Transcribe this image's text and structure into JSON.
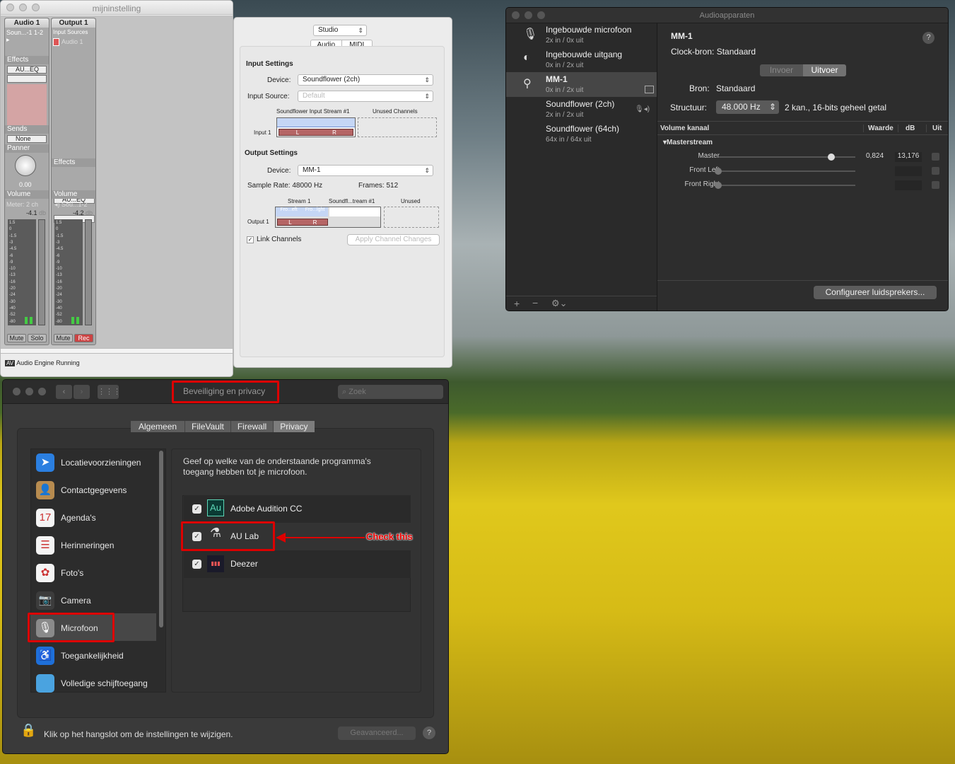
{
  "aulab": {
    "window_title": "mijninstelling",
    "strip1": {
      "title": "Audio 1",
      "source": "Soun...-1 1-2",
      "effects": "Effects",
      "effect1": "AU...EQ",
      "sends": "Sends",
      "send1": "None",
      "panner": "Panner",
      "pan_value": "0.00",
      "volume": "Volume",
      "meter": "Meter: 2 ch",
      "db": "-4.1",
      "db_unit": "db",
      "mute": "Mute",
      "solo": "Solo"
    },
    "strip2": {
      "title": "Output 1",
      "input_sources": "Input Sources",
      "input1": "Audio 1",
      "effects": "Effects",
      "effect1": "AU...EQ",
      "volume": "Volume",
      "output": "Sou...1-2",
      "db": "-4.2",
      "db_unit": "db",
      "mute": "Mute",
      "rec": "Rec"
    },
    "scale": [
      "1.5",
      "0",
      "-1.5",
      "-3",
      "-4.5",
      "-6",
      "-9",
      "-10",
      "-13",
      "-16",
      "-20",
      "-24",
      "-30",
      "-40",
      "-52",
      "-80"
    ],
    "status": "Audio Engine Running"
  },
  "midi": {
    "config": "Studio",
    "tab_audio": "Audio",
    "tab_midi": "MIDI",
    "input_settings": "Input Settings",
    "device_label": "Device:",
    "input_device": "Soundflower (2ch)",
    "input_source_label": "Input Source:",
    "input_source": "Default",
    "in_stream": "Soundflower Input Stream #1",
    "unused_channels": "Unused Channels",
    "input1": "Input 1",
    "output_settings": "Output Settings",
    "output_device": "MM-1",
    "sample_rate": "Sample Rate:  48000 Hz",
    "frames": "Frames:  512",
    "stream1": "Stream 1",
    "stream2": "Soundfl...tream #1",
    "unused": "Unused",
    "output1": "Output 1",
    "ch_fl": "Fro...eft",
    "ch_fr": "Fro...ight",
    "L": "L",
    "R": "R",
    "link_channels": "Link Channels",
    "apply": "Apply Channel Changes"
  },
  "audiodev": {
    "title": "Audioapparaten",
    "devices": [
      {
        "name": "Ingebouwde microfoon",
        "sub": "2x in / 0x uit",
        "icon": "microphone-icon",
        "glyph": "🎙"
      },
      {
        "name": "Ingebouwde uitgang",
        "sub": "0x in / 2x uit",
        "icon": "speaker-icon",
        "glyph": "◐"
      },
      {
        "name": "MM-1",
        "sub": "0x in / 2x uit",
        "icon": "usb-icon",
        "glyph": "⚲"
      },
      {
        "name": "Soundflower (2ch)",
        "sub": "2x in / 2x uit",
        "icon": "",
        "glyph": ""
      },
      {
        "name": "Soundflower (64ch)",
        "sub": "64x in / 64x uit",
        "icon": "",
        "glyph": ""
      }
    ],
    "selected_name": "MM-1",
    "clock_label": "Clock-bron:",
    "clock_value": "Standaard",
    "tab_in": "Invoer",
    "tab_out": "Uitvoer",
    "source_label": "Bron:",
    "source_value": "Standaard",
    "structure_label": "Structuur:",
    "rate": "48.000 Hz",
    "format": "2 kan., 16-bits geheel getal",
    "col_channel": "Volume kanaal",
    "col_value": "Waarde",
    "col_db": "dB",
    "col_mute": "Uit",
    "group": "Masterstream",
    "rows": [
      {
        "name": "Master",
        "value": "0,824",
        "db": "13,176",
        "level": 0.824
      },
      {
        "name": "Front Left",
        "value": "",
        "db": "",
        "level": 0
      },
      {
        "name": "Front Right",
        "value": "",
        "db": "",
        "level": 0
      }
    ],
    "configure": "Configureer luidsprekers...",
    "help": "?"
  },
  "security": {
    "title": "Beveiliging en privacy",
    "search_placeholder": "Zoek",
    "tabs": [
      "Algemeen",
      "FileVault",
      "Firewall",
      "Privacy"
    ],
    "sidebar": [
      {
        "label": "Locatievoorzieningen",
        "icon": "location-arrow-icon",
        "glyph": "➤",
        "color": "#2b7fe0"
      },
      {
        "label": "Contactgegevens",
        "icon": "contacts-book-icon",
        "glyph": "👤",
        "color": "#b78b4f"
      },
      {
        "label": "Agenda's",
        "icon": "calendar-icon",
        "glyph": "17",
        "color": "#f4f4f4"
      },
      {
        "label": "Herinneringen",
        "icon": "reminders-icon",
        "glyph": "☰",
        "color": "#f4f4f4"
      },
      {
        "label": "Foto's",
        "icon": "photos-icon",
        "glyph": "✿",
        "color": "#f4f4f4"
      },
      {
        "label": "Camera",
        "icon": "camera-icon",
        "glyph": "📷",
        "color": "#3c3c3c"
      },
      {
        "label": "Microfoon",
        "icon": "microphone-icon",
        "glyph": "🎙",
        "color": "#8a8a8a"
      },
      {
        "label": "Toegankelijkheid",
        "icon": "accessibility-icon",
        "glyph": "♿",
        "color": "#1e6fd9"
      },
      {
        "label": "Volledige schijftoegang",
        "icon": "folder-icon",
        "glyph": "",
        "color": "#4aa3e0"
      }
    ],
    "description": "Geef op welke van de onderstaande programma's toegang hebben tot je microfoon.",
    "apps": [
      {
        "name": "Adobe Audition CC",
        "icon": "adobe-audition-icon",
        "glyph": "Au"
      },
      {
        "name": "AU Lab",
        "icon": "au-lab-icon",
        "glyph": "⚗"
      },
      {
        "name": "Deezer",
        "icon": "deezer-icon",
        "glyph": "▮▮▮"
      }
    ],
    "annotation": "Check this",
    "lock_text": "Klik op het hangslot om de instellingen te wijzigen.",
    "advanced": "Geavanceerd...",
    "help": "?"
  }
}
